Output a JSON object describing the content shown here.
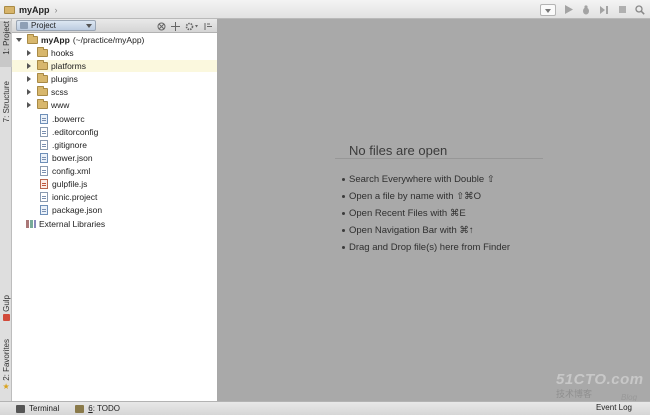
{
  "navbar": {
    "crumb": "myApp",
    "crumb_arrow": "›",
    "icons": [
      "run-icon",
      "debug-icon",
      "coverage-icon",
      "stop-icon",
      "search-icon"
    ]
  },
  "tool_windows": {
    "project_tab": "1: Project",
    "structure_tab": "7: Structure",
    "gulp_tab": "Gulp",
    "favorites_tab": "2: Favorites"
  },
  "project_panel": {
    "view_label": "Project",
    "root_name": "myApp",
    "root_path": "(~/practice/myApp)",
    "folders": [
      "hooks",
      "platforms",
      "plugins",
      "scss",
      "www"
    ],
    "files": [
      ".bowerrc",
      ".editorconfig",
      ".gitignore",
      "bower.json",
      "config.xml",
      "gulpfile.js",
      "ionic.project",
      "package.json"
    ],
    "external": "External Libraries"
  },
  "editor": {
    "empty_title": "No files are open",
    "hints": [
      "Search Everywhere with Double ⇧",
      "Open a file by name with ⇧⌘O",
      "Open Recent Files with ⌘E",
      "Open Navigation Bar with ⌘↑",
      "Drag and Drop file(s) here from Finder"
    ]
  },
  "watermark": {
    "main": "51CTO.com",
    "sub": "技术博客",
    "blog": "Blog"
  },
  "bottom_bar": {
    "terminal": "Terminal",
    "todo_num": "6",
    "todo_label": ": TODO",
    "event_log": "Event Log"
  }
}
